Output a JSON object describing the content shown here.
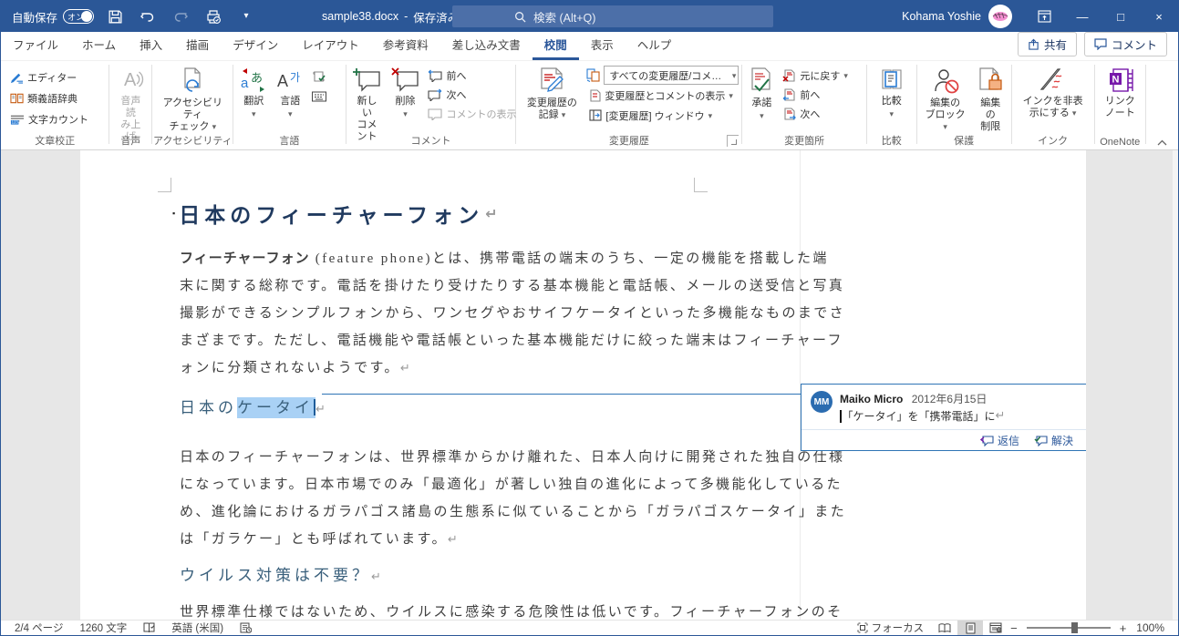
{
  "titlebar": {
    "autosave_label": "自動保存",
    "autosave_state": "オン",
    "filename": "sample38.docx",
    "separator": "-",
    "file_status": "保存済み",
    "search_placeholder": "検索 (Alt+Q)",
    "user_name": "Kohama Yoshie"
  },
  "tabs": [
    "ファイル",
    "ホーム",
    "挿入",
    "描画",
    "デザイン",
    "レイアウト",
    "参考資料",
    "差し込み文書",
    "校閲",
    "表示",
    "ヘルプ"
  ],
  "top_right": {
    "share": "共有",
    "comments": "コメント"
  },
  "ribbon": {
    "proofing": {
      "label": "文章校正",
      "editor": "エディター",
      "thesaurus": "類義語辞典",
      "word_count": "文字カウント"
    },
    "speech": {
      "label": "音声",
      "read_aloud_l1": "音声読",
      "read_aloud_l2": "み上げ"
    },
    "accessibility": {
      "label": "アクセシビリティ",
      "check_l1": "アクセシビリティ",
      "check_l2": "チェック"
    },
    "language": {
      "label": "言語",
      "translate": "翻訳",
      "language": "言語"
    },
    "comments": {
      "label": "コメント",
      "new_l1": "新しい",
      "new_l2": "コメント",
      "delete": "削除",
      "previous": "前へ",
      "next": "次へ",
      "show": "コメントの表示"
    },
    "tracking": {
      "label": "変更履歴",
      "record_l1": "変更履歴の",
      "record_l2": "記録",
      "display_combo": "すべての変更履歴/コメ…",
      "show_markup": "変更履歴とコメントの表示",
      "pane": "[変更履歴] ウィンドウ"
    },
    "changes": {
      "label": "変更箇所",
      "accept": "承諾",
      "reject": "元に戻す",
      "previous": "前へ",
      "next": "次へ"
    },
    "compare": {
      "label": "比較",
      "compare": "比較"
    },
    "protect": {
      "label": "保護",
      "block_l1": "編集の",
      "block_l2": "ブロック",
      "restrict_l1": "編集の",
      "restrict_l2": "制限"
    },
    "ink": {
      "label": "インク",
      "hide_l1": "インクを非表",
      "hide_l2": "示にする"
    },
    "onenote": {
      "label": "OneNote",
      "linked_l1": "リンク",
      "linked_l2": "ノート"
    }
  },
  "document": {
    "title": "日本のフィーチャーフォン",
    "p1_bold": "フィーチャーフォン",
    "p1_lines": [
      " (feature phone)とは、携帯電話の端末のうち、一定の機能を搭載した端",
      "末に関する総称です。電話を掛けたり受けたりする基本機能と電話帳、メールの送受信と写真",
      "撮影ができるシンプルフォンから、ワンセグやおサイフケータイといった多機能なものまでさ",
      "まざまです。ただし、電話機能や電話帳といった基本機能だけに絞った端末はフィーチャーフ",
      "ォンに分類されないようです。"
    ],
    "h1_pre": "日本の",
    "h1_selected": "ケータイ",
    "p2_lines": [
      "日本のフィーチャーフォンは、世界標準からかけ離れた、日本人向けに開発された独自の仕様",
      "になっています。日本市場でのみ「最適化」が著しい独自の進化によって多機能化しているた",
      "め、進化論におけるガラパゴス諸島の生態系に似ていることから「ガラパゴスケータイ」また",
      "は「ガラケー」とも呼ばれています。"
    ],
    "h2": "ウイルス対策は不要？",
    "p3_line": "世界標準仕様ではないため、ウイルスに感染する危険性は低いです。フィーチャーフォンのそ"
  },
  "comment": {
    "initials": "MM",
    "author": "Maiko Micro",
    "date": "2012年6月15日",
    "text": "「ケータイ」を「携帯電話」に",
    "reply": "返信",
    "resolve": "解決"
  },
  "statusbar": {
    "page": "2/4 ページ",
    "words": "1260 文字",
    "language": "英語 (米国)",
    "focus": "フォーカス",
    "zoom": "100%"
  },
  "glyphs": {
    "pilcrow": "↵",
    "bullet": "▪",
    "chevron": "▾",
    "minimize": "—",
    "maximize": "□",
    "close": "×",
    "zoom_out": "−",
    "zoom_in": "+",
    "translate_kana": "あ",
    "latin_a": "A",
    "hangul_ga": "가",
    "read_aloud_a": "A",
    "count_123": "123"
  },
  "colors": {
    "titlebar": "#2B5797",
    "accent": "#2B579A",
    "selection": "#A9D1F5",
    "comment_border": "#2E74B5",
    "heading_text": "#3A607C",
    "title_text": "#203A5F"
  }
}
